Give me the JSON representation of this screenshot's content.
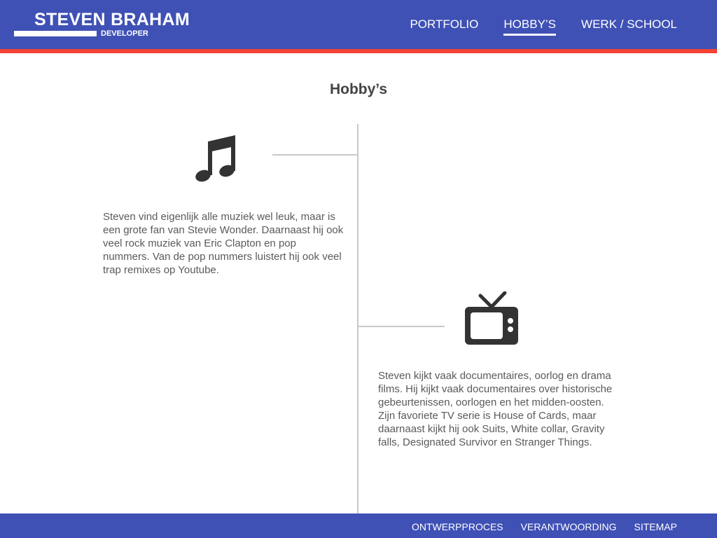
{
  "header": {
    "name": "STEVEN BRAHAM",
    "role": "DEVELOPER",
    "nav": [
      {
        "label": "PORTFOLIO",
        "active": false
      },
      {
        "label": "HOBBY’S",
        "active": true
      },
      {
        "label": "WERK / SCHOOL",
        "active": false
      }
    ],
    "colors": {
      "primary": "#3f51b5",
      "accent": "#f44336"
    }
  },
  "main": {
    "title": "Hobby’s",
    "hobbies": [
      {
        "icon": "music-note-icon",
        "text": "Steven vind eigenlijk alle muziek wel leuk, maar is een grote fan van Stevie Wonder. Daarnaast hij ook veel rock muziek van Eric Clapton en pop nummers. Van de pop nummers luistert hij ook veel trap remixes op Youtube."
      },
      {
        "icon": "tv-icon",
        "text": "Steven kijkt vaak documentaires, oorlog en drama films. Hij kijkt vaak documentaires over historische gebeurtenissen, oorlogen en het midden-oosten.  Zijn favoriete TV serie is House of Cards, maar daarnaast kijkt hij ook Suits, White collar, Gravity falls, Designated Survivor en Stranger Things."
      }
    ]
  },
  "footer": {
    "links": [
      "ONTWERPPROCES",
      "VERANTWOORDING",
      "SITEMAP"
    ]
  }
}
